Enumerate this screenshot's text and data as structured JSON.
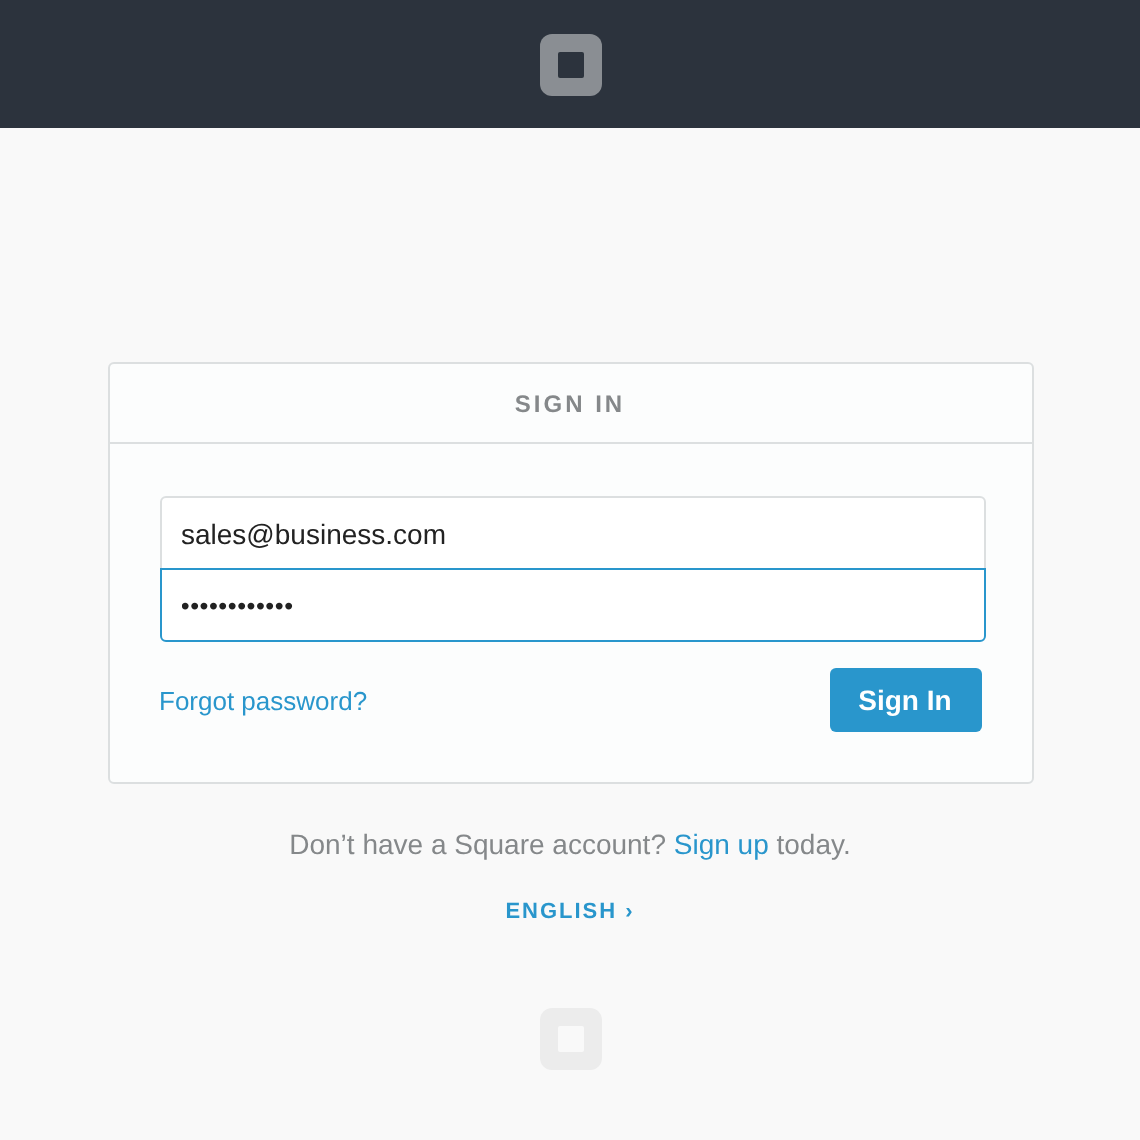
{
  "card": {
    "title": "SIGN IN",
    "fields": [
      {
        "kind": "email",
        "value": "sales@business.com",
        "focused": false
      },
      {
        "kind": "password",
        "value": "••••••••••••",
        "focused": true
      }
    ],
    "forgot_link": "Forgot password?",
    "submit_button": "Sign In"
  },
  "signup": {
    "before": "Don’t have a Square account?",
    "link": "Sign up",
    "after": "today."
  },
  "language_link": "ENGLISH ›"
}
